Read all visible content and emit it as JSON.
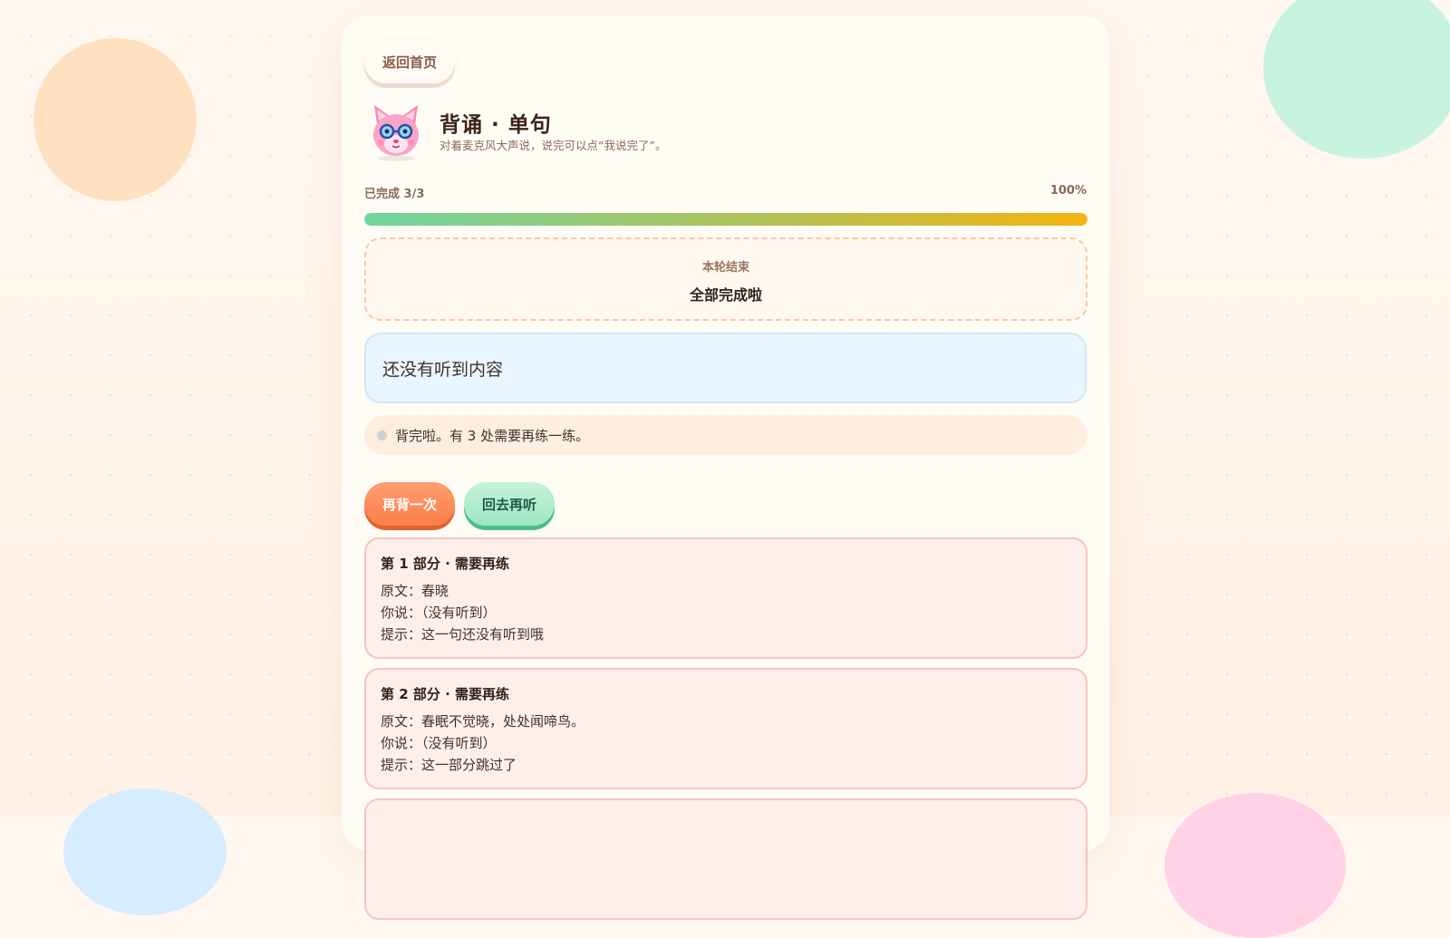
{
  "header": {
    "back_label": "返回首页",
    "title": "背诵 · 单句",
    "subtitle": "对着麦克风大声说，说完可以点“我说完了”。"
  },
  "progress": {
    "label": "已完成 3/3",
    "percent_label": "100%",
    "fraction": 1.0
  },
  "round": {
    "kicker": "本轮结束",
    "message": "全部完成啦"
  },
  "transcript": {
    "text": "还没有听到内容"
  },
  "status": {
    "text": "背完啦。有 3 处需要再练一练。"
  },
  "actions": {
    "retry_label": "再背一次",
    "relisten_label": "回去再听"
  },
  "parts": [
    {
      "title": "第 1 部分 · 需要再练",
      "original": "原文：春晓",
      "said": "你说：（没有听到）",
      "hint": "提示：这一句还没有听到哦"
    },
    {
      "title": "第 2 部分 · 需要再练",
      "original": "原文：春眠不觉晓，处处闻啼鸟。",
      "said": "你说：（没有听到）",
      "hint": "提示：这一部分跳过了"
    },
    {
      "title": "",
      "original": "",
      "said": "",
      "hint": ""
    }
  ],
  "colors": {
    "accent_orange": "#fb7e48",
    "accent_green": "#9fe6c3",
    "progress_start": "#6fd49e",
    "progress_end": "#f5b30f",
    "needs_practice_bg": "#ffefec"
  },
  "icons": {
    "avatar": "pink-cat-with-glasses-avatar",
    "status_dot": "gray-dot-icon"
  }
}
